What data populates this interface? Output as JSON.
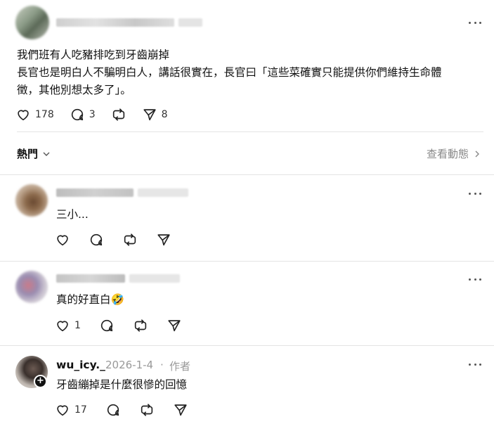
{
  "post": {
    "lines": [
      "我們班有人吃豬排吃到牙齒崩掉",
      "長官也是明白人不騙明白人，講話很實在，長官曰「這些菜確實只能提供你們維持生命體",
      "徵，其他別想太多了」。"
    ],
    "likes": "178",
    "comments": "3",
    "shares": "8"
  },
  "filter": {
    "label": "熱門",
    "view_activity": "查看動態"
  },
  "replies": [
    {
      "text": "三小..."
    },
    {
      "text": "真的好直白🤣",
      "likes": "1"
    },
    {
      "username": "wu_icy._",
      "date": "2026-1-4",
      "separator": "·",
      "author_badge": "作者",
      "text": "牙齒繃掉是什麼很慘的回憶",
      "likes": "17"
    }
  ],
  "icons": {
    "like": "heart-icon",
    "comment": "comment-icon",
    "repost": "repost-icon",
    "share": "share-icon",
    "more": "more-icon",
    "follow": "plus-icon"
  }
}
